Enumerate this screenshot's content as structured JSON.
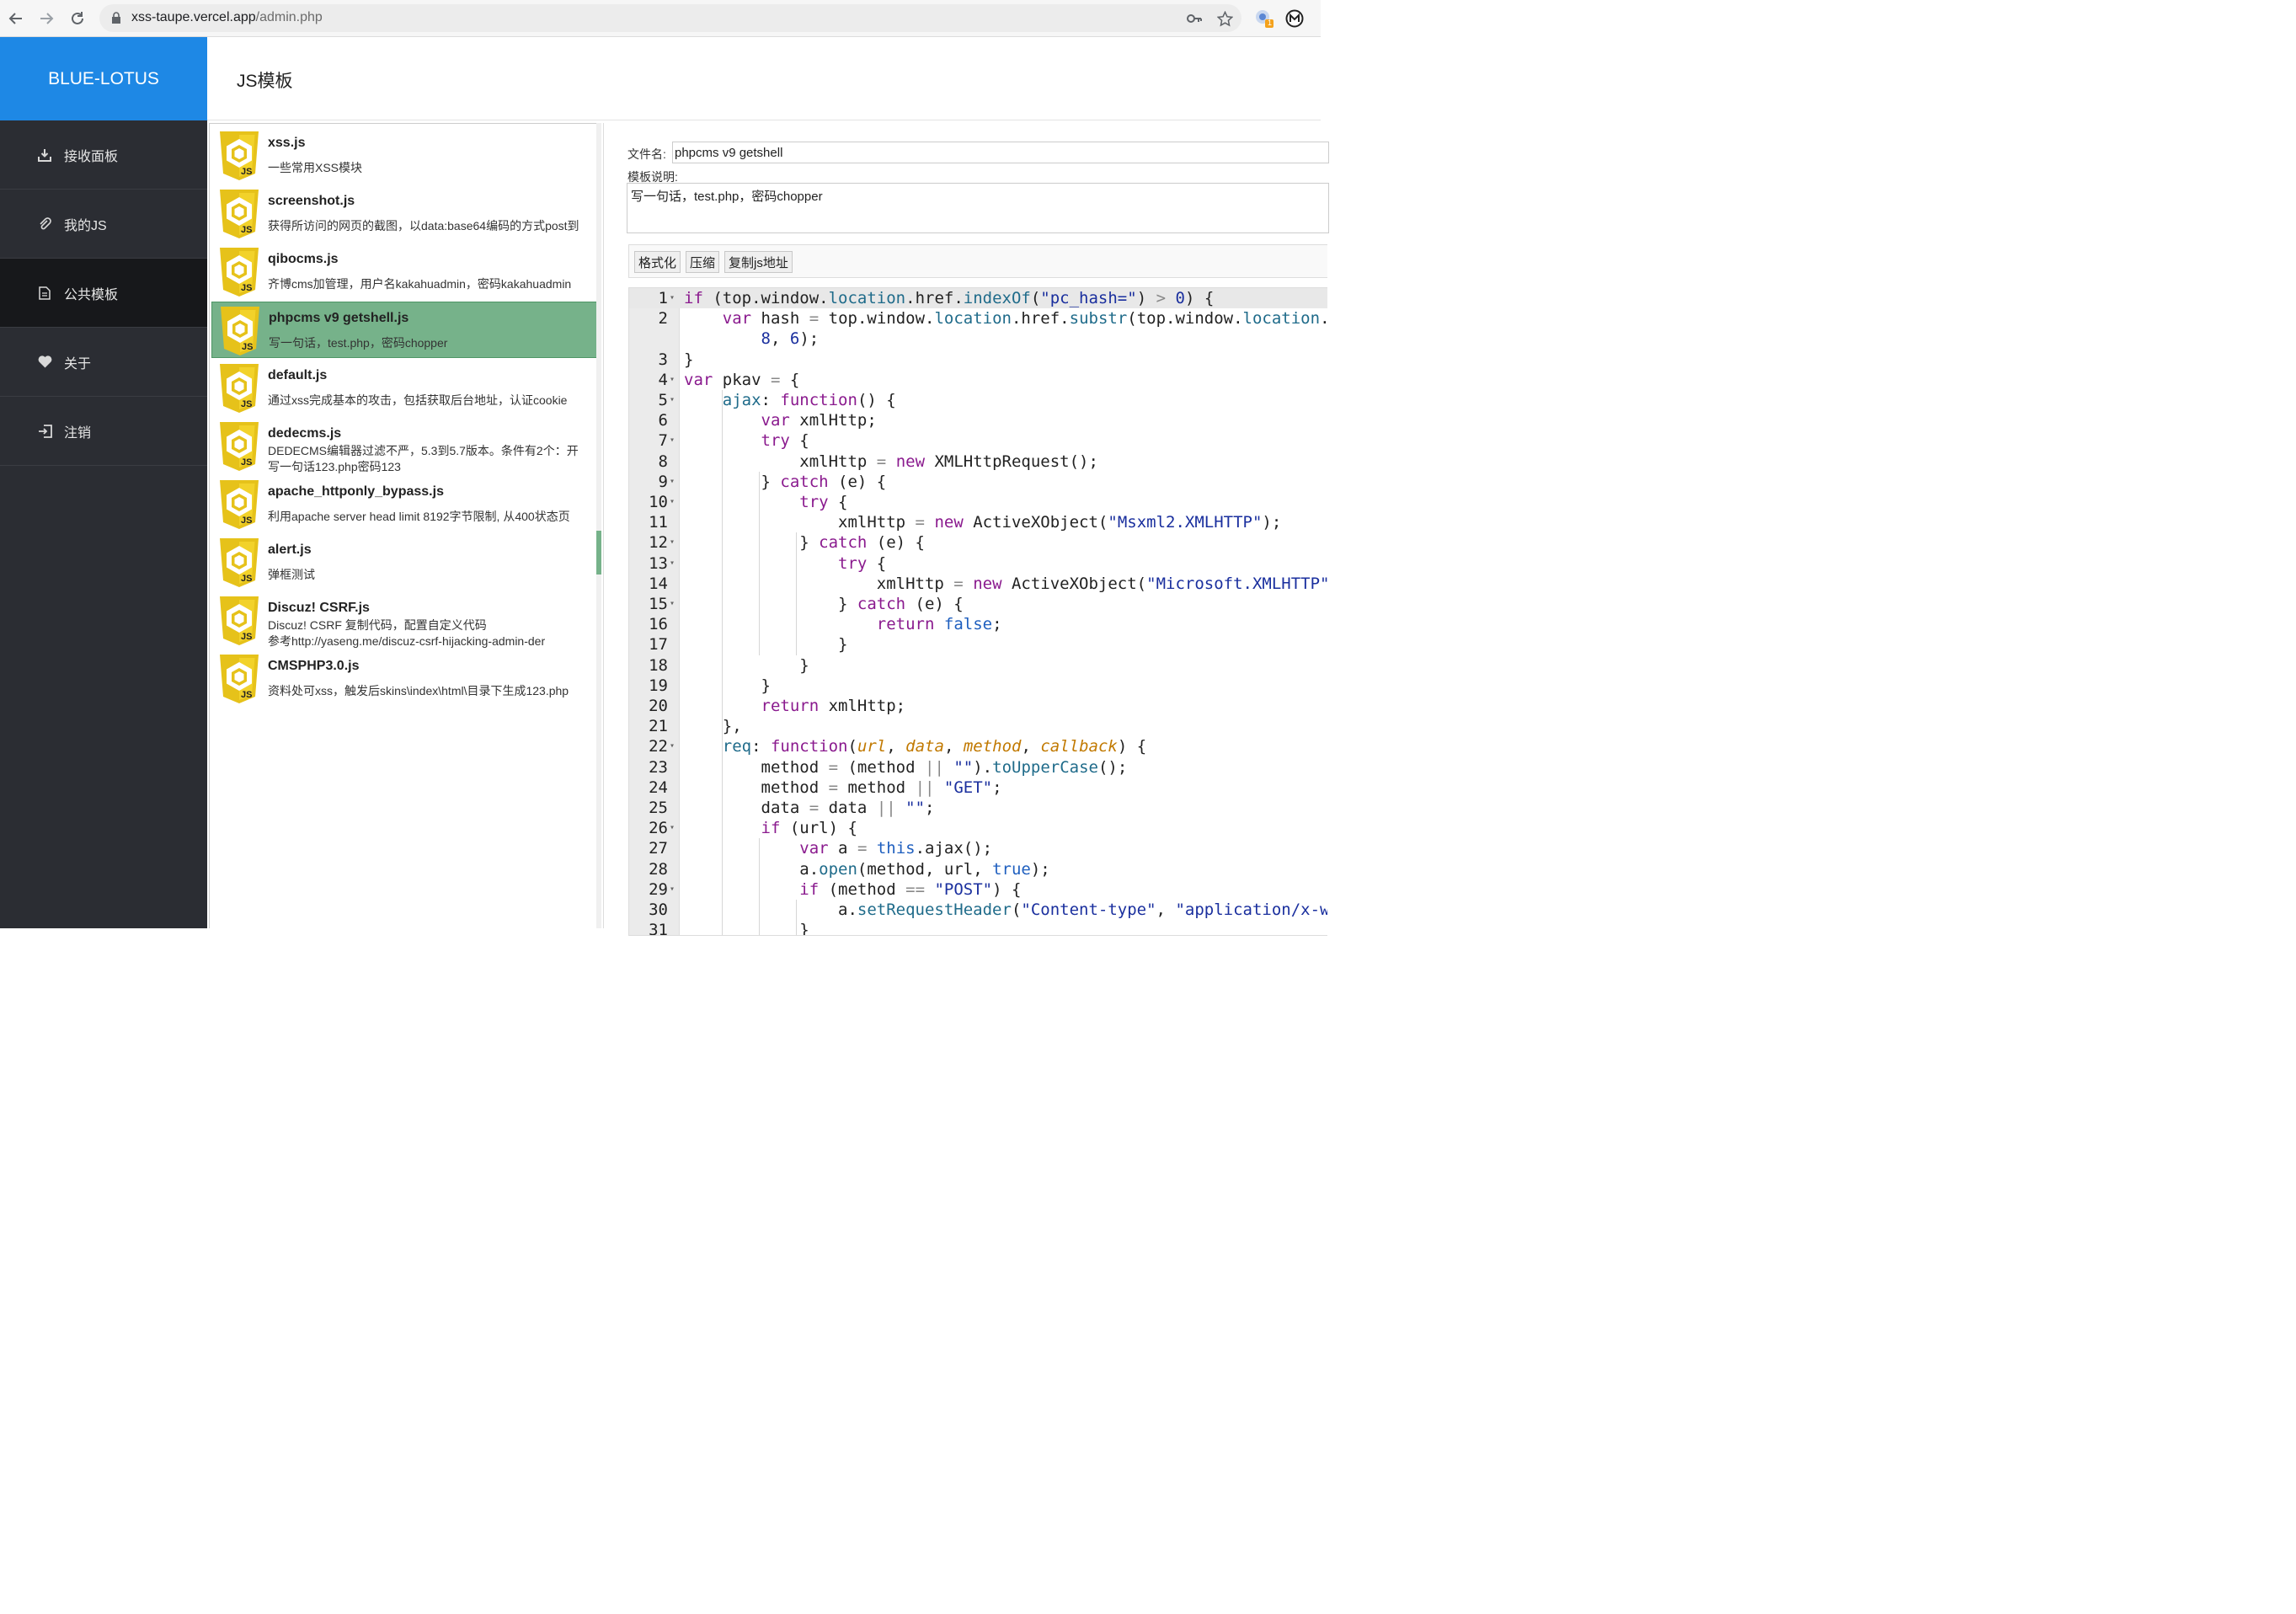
{
  "browser": {
    "url_host": "xss-taupe.vercel.app",
    "url_path": "/admin.php",
    "ext_badge": "1"
  },
  "app": {
    "brand": "BLUE-LOTUS",
    "page_title": "JS模板"
  },
  "sidebar": {
    "items": [
      {
        "label": "接收面板",
        "icon": "download-tray-icon",
        "active": false
      },
      {
        "label": "我的JS",
        "icon": "paperclip-icon",
        "active": false
      },
      {
        "label": "公共模板",
        "icon": "document-icon",
        "active": true
      },
      {
        "label": "关于",
        "icon": "heart-icon",
        "active": false
      },
      {
        "label": "注销",
        "icon": "logout-icon",
        "active": false
      }
    ]
  },
  "templates": [
    {
      "name": "xss.js",
      "desc": [
        "一些常用XSS模块"
      ]
    },
    {
      "name": "screenshot.js",
      "desc": [
        "获得所访问的网页的截图，以data:base64编码的方式post到"
      ]
    },
    {
      "name": "qibocms.js",
      "desc": [
        "齐博cms加管理，用户名kakahuadmin，密码kakahuadmin"
      ]
    },
    {
      "name": "phpcms v9 getshell.js",
      "desc": [
        "写一句话，test.php，密码chopper"
      ],
      "selected": true
    },
    {
      "name": "default.js",
      "desc": [
        "通过xss完成基本的攻击，包括获取后台地址，认证cookie"
      ]
    },
    {
      "name": "dedecms.js",
      "desc": [
        "DEDECMS编辑器过滤不严，5.3到5.7版本。条件有2个：开",
        "写一句话123.php密码123"
      ]
    },
    {
      "name": "apache_httponly_bypass.js",
      "desc": [
        "利用apache server head limit 8192字节限制, 从400状态页"
      ]
    },
    {
      "name": "alert.js",
      "desc": [
        "弹框测试"
      ]
    },
    {
      "name": "Discuz!  CSRF.js",
      "desc": [
        "Discuz!  CSRF  复制代码，配置自定义代码",
        "参考http://yaseng.me/discuz-csrf-hijacking-admin-der"
      ]
    },
    {
      "name": "CMSPHP3.0.js",
      "desc": [
        "资料处可xss，触发后skins\\index\\html\\目录下生成123.php"
      ]
    }
  ],
  "editor": {
    "filename_label": "文件名:",
    "filename_value": "phpcms v9 getshell",
    "desc_label": "模板说明:",
    "desc_value": "写一句话，test.php，密码chopper",
    "buttons": {
      "format": "格式化",
      "compress": "压缩",
      "copy_url": "复制js地址"
    },
    "line_numbers": [
      "1",
      "2",
      "",
      "3",
      "4",
      "5",
      "6",
      "7",
      "8",
      "9",
      "10",
      "11",
      "12",
      "13",
      "14",
      "15",
      "16",
      "17",
      "18",
      "19",
      "20",
      "21",
      "22",
      "23",
      "24",
      "25",
      "26",
      "27",
      "28",
      "29",
      "30",
      "31"
    ]
  }
}
